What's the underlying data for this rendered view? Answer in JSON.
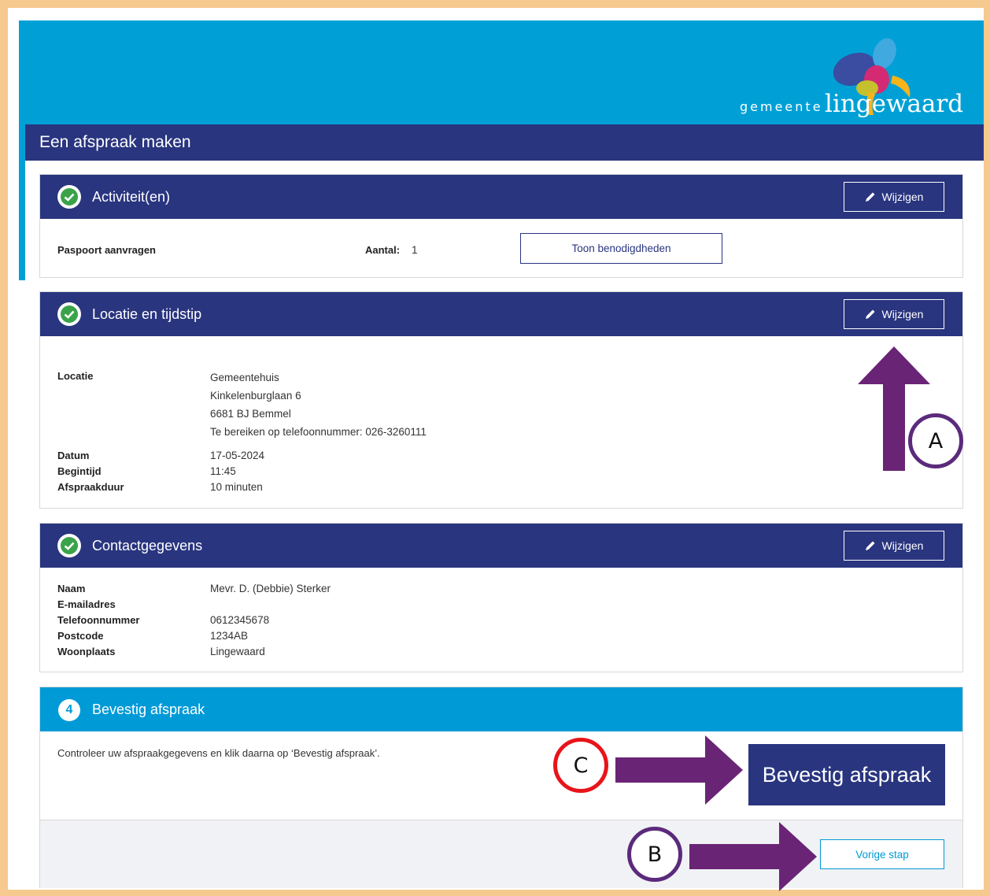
{
  "brand": {
    "prefix": "gemeente",
    "name": "lingewaard"
  },
  "page_title": "Een afspraak maken",
  "sections": {
    "activity": {
      "title": "Activiteit(en)",
      "edit_label": "Wijzigen",
      "item": "Paspoort aanvragen",
      "count_label": "Aantal:",
      "count_value": "1",
      "requirements_button": "Toon benodigdheden"
    },
    "location": {
      "title": "Locatie en tijdstip",
      "edit_label": "Wijzigen",
      "location_label": "Locatie",
      "location_lines": [
        "Gemeentehuis",
        "Kinkelenburglaan 6",
        "6681 BJ Bemmel",
        "Te bereiken op telefoonnummer: 026-3260111"
      ],
      "date_label": "Datum",
      "date_value": "17-05-2024",
      "start_label": "Begintijd",
      "start_value": "11:45",
      "duration_label": "Afspraakduur",
      "duration_value": "10 minuten"
    },
    "contact": {
      "title": "Contactgegevens",
      "edit_label": "Wijzigen",
      "name_label": "Naam",
      "name_value": "Mevr. D. (Debbie) Sterker",
      "email_label": "E-mailadres",
      "email_value": "",
      "phone_label": "Telefoonnummer",
      "phone_value": "0612345678",
      "postcode_label": "Postcode",
      "postcode_value": "1234AB",
      "city_label": "Woonplaats",
      "city_value": "Lingewaard"
    },
    "confirm": {
      "step": "4",
      "title": "Bevestig afspraak",
      "instruction": "Controleer uw afspraakgegevens en klik daarna op ‘Bevestig afspraak’.",
      "confirm_button": "Bevestig afspraak",
      "previous_button": "Vorige stap"
    }
  },
  "annotations": {
    "a": "A",
    "b": "B",
    "c": "C"
  },
  "colors": {
    "header_blue": "#00a0d6",
    "navy": "#29357f",
    "arrow_purple": "#6a2475",
    "circle_red": "#e8141a",
    "frame_peach": "#f6c98e"
  }
}
